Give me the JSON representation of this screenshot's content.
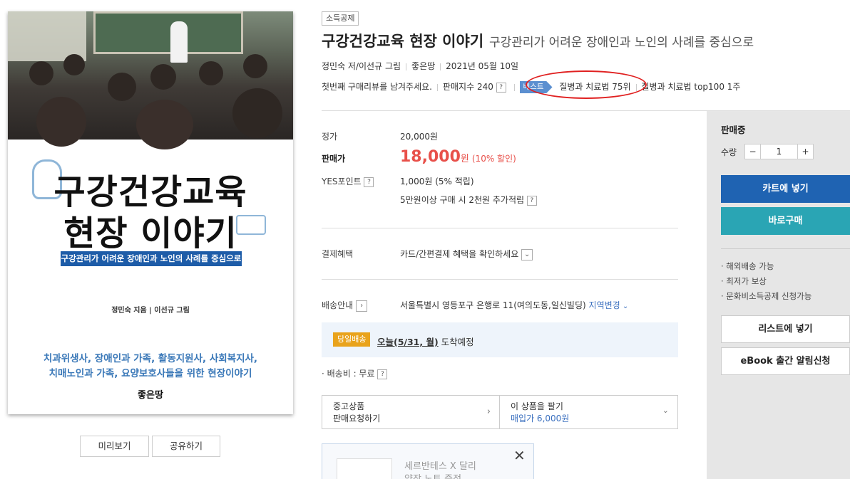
{
  "cover": {
    "title_line1": "구강건강교육",
    "title_line2": "현장 이야기",
    "band": "구강관리가 어려운 장애인과 노인의 사례를 중심으로",
    "authors": "정민숙 지음 | 이선규 그림",
    "tagline1": "치과위생사, 장애인과 가족, 활동지원사, 사회복지사,",
    "tagline2": "치매노인과 가족, 요양보호사들을 위한 현장이야기",
    "publisher": "좋은땅"
  },
  "cover_buttons": {
    "preview": "미리보기",
    "share": "공유하기"
  },
  "product": {
    "category_tag": "소득공제",
    "title": "구강건강교육 현장 이야기",
    "subtitle": "구강관리가 어려운 장애인과 노인의 사례를 중심으로",
    "author": "정민숙 저/이선규 그림",
    "publisher": "좋은땅",
    "date": "2021년 05월 10일",
    "review_prompt": "첫번째 구매리뷰를 남겨주세요.",
    "sales_index": "판매지수 240",
    "help_mark": "?",
    "best_badge": "베스트",
    "rank1": "질병과 치료법 75위",
    "rank2": "질병과 치료법 top100 1주"
  },
  "price": {
    "list_label": "정가",
    "list_value": "20,000원",
    "sale_label": "판매가",
    "sale_value": "18,000",
    "sale_unit": "원",
    "discount": "(10% 할인)",
    "points_label": "YES포인트",
    "points_value": "1,000원 (5% 적립)",
    "points_extra": "5만원이상 구매 시 2천원 추가적립"
  },
  "payment": {
    "label": "결제혜택",
    "value": "카드/간편결제 혜택을 확인하세요"
  },
  "shipping": {
    "label": "배송안내",
    "address": "서울특별시 영등포구 은행로 11(여의도동,일신빌딩)",
    "change_link": "지역변경",
    "same_day_badge": "당일배송",
    "arrival_date": "오늘(5/31, 월)",
    "arrival_suffix": "도착예정",
    "fee": "· 배송비 : 무료"
  },
  "used": {
    "left_line1": "중고상품",
    "left_line2": "판매요청하기",
    "right_line1": "이 상품을 팔기",
    "right_line2": "매입가 6,000원"
  },
  "promo": {
    "line1": "세르반테스 X 달리",
    "line2": "양장 노트 증정",
    "close": "✕"
  },
  "panel": {
    "status": "판매중",
    "qty_label": "수량",
    "qty_value": "1",
    "minus": "−",
    "plus": "+",
    "cart_button": "카트에 넣기",
    "buy_button": "바로구매",
    "perks": [
      "· 해외배송 가능",
      "· 최저가 보상",
      "· 문화비소득공제 신청가능"
    ],
    "list_button": "리스트에 넣기",
    "ebook_button": "eBook 출간 알림신청"
  },
  "colors": {
    "sale_red": "#e8504a",
    "cart_blue": "#1f63b2",
    "buy_teal": "#2aa5b4",
    "best_blue": "#5b8fd0",
    "highlight_red": "#e02020"
  }
}
